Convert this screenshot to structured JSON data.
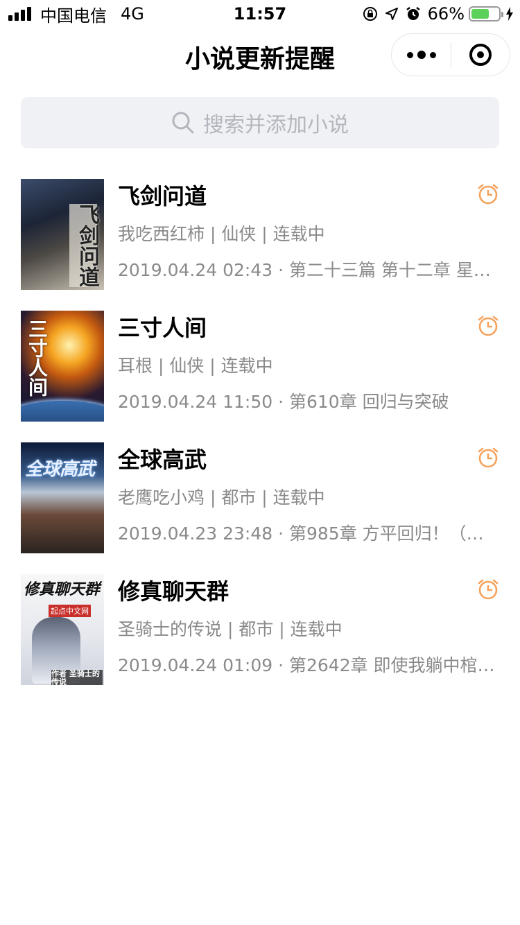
{
  "status_bar": {
    "carrier": "中国电信",
    "network": "4G",
    "time": "11:57",
    "battery": "66%",
    "battery_level": 0.66,
    "battery_color": "#5cd15a"
  },
  "nav": {
    "title": "小说更新提醒"
  },
  "search": {
    "placeholder": "搜索并添加小说"
  },
  "colors": {
    "alarm": "#f5a25d",
    "meta_text": "#8a8a8a",
    "search_bg": "#f0f1f5"
  },
  "novels": [
    {
      "title": "飞剑问道",
      "meta": "我吃西红柿 | 仙侠 | 连载中",
      "update": "2019.04.24 02:43 · 第二十三篇 第十二章 星…",
      "cover_text": "飞剑问道",
      "alarm_icon": "alarm-clock-icon"
    },
    {
      "title": "三寸人间",
      "meta": "耳根 | 仙侠 | 连载中",
      "update": "2019.04.24 11:50 · 第610章 回归与突破",
      "cover_text": "三寸人间",
      "alarm_icon": "alarm-clock-icon"
    },
    {
      "title": "全球高武",
      "meta": "老鹰吃小鸡 | 都市 | 连载中",
      "update": "2019.04.23 23:48 · 第985章 方平回归！（…",
      "cover_text": "全球高武",
      "alarm_icon": "alarm-clock-icon"
    },
    {
      "title": "修真聊天群",
      "meta": "圣骑士的传说 | 都市 | 连载中",
      "update": "2019.04.24 01:09 · 第2642章 即使我躺中棺…",
      "cover_text": "修真聊天群",
      "cover_subtext": "起点中文网",
      "cover_author": "作者 圣骑士的传说",
      "alarm_icon": "alarm-clock-icon"
    }
  ]
}
